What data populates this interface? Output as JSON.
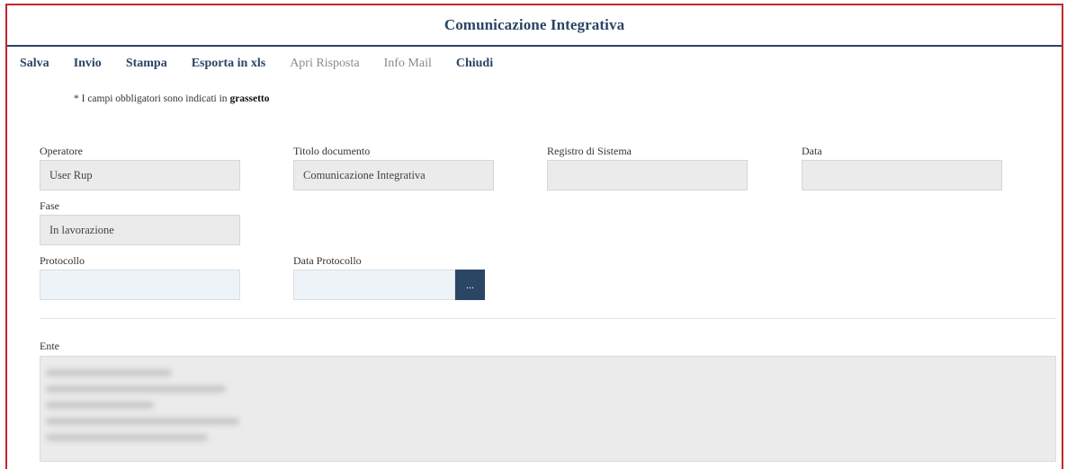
{
  "header": {
    "title": "Comunicazione Integrativa"
  },
  "toolbar": {
    "items": [
      {
        "label": "Salva",
        "state": "active"
      },
      {
        "label": "Invio",
        "state": "active"
      },
      {
        "label": "Stampa",
        "state": "active"
      },
      {
        "label": "Esporta in xls",
        "state": "active"
      },
      {
        "label": "Apri Risposta",
        "state": "disabled"
      },
      {
        "label": "Info Mail",
        "state": "disabled"
      },
      {
        "label": "Chiudi",
        "state": "active"
      }
    ]
  },
  "note": {
    "prefix": "* I campi obbligatori sono indicati in ",
    "bold": "grassetto"
  },
  "form": {
    "operatore": {
      "label": "Operatore",
      "value": "User Rup"
    },
    "titolo_documento": {
      "label": "Titolo documento",
      "value": "Comunicazione Integrativa"
    },
    "registro_sistema": {
      "label": "Registro di Sistema",
      "value": ""
    },
    "data": {
      "label": "Data",
      "value": ""
    },
    "fase": {
      "label": "Fase",
      "value": "In lavorazione"
    },
    "protocollo": {
      "label": "Protocollo",
      "value": ""
    },
    "data_protocollo": {
      "label": "Data Protocollo",
      "value": "",
      "button_label": "..."
    },
    "ente": {
      "label": "Ente",
      "value_redacted": true
    }
  },
  "colors": {
    "accent": "#2b4565",
    "frame_border": "#c0272d",
    "readonly_field": "#ebebeb",
    "editable_field": "#eef3f8"
  }
}
